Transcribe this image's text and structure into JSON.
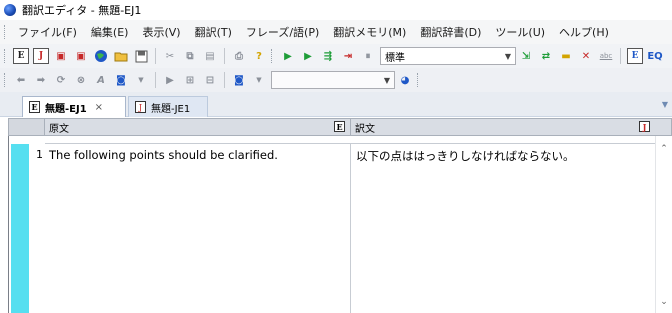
{
  "window": {
    "title": "翻訳エディタ - 無題-EJ1"
  },
  "menu": [
    {
      "label": "ファイル(F)",
      "name": "menu-file"
    },
    {
      "label": "編集(E)",
      "name": "menu-edit"
    },
    {
      "label": "表示(V)",
      "name": "menu-view"
    },
    {
      "label": "翻訳(T)",
      "name": "menu-translate"
    },
    {
      "label": "フレーズ/語(P)",
      "name": "menu-phrase"
    },
    {
      "label": "翻訳メモリ(M)",
      "name": "menu-translation-memory"
    },
    {
      "label": "翻訳辞書(D)",
      "name": "menu-dictionary"
    },
    {
      "label": "ツール(U)",
      "name": "menu-tools"
    },
    {
      "label": "ヘルプ(H)",
      "name": "menu-help"
    }
  ],
  "toolbar": {
    "style_combo_value": "標準",
    "main_combo_value": "",
    "abc_label": "abc"
  },
  "tabs": [
    {
      "label": "無題-EJ1",
      "icon_letter": "E",
      "close": "×",
      "active": true
    },
    {
      "label": "無題-JE1",
      "icon_letter": "J",
      "active": false
    }
  ],
  "grid": {
    "header_source": "原文",
    "header_target": "訳文",
    "source_icon_letter": "E",
    "target_icon_letter": "J",
    "rows": [
      {
        "number": "1",
        "source": "The following points should be clarified.",
        "target": "以下の点ははっきりしなければならない。"
      }
    ]
  },
  "colors": {
    "marker": "#56dff0",
    "menubar": "#f5f6f7",
    "toolbar": "#f1f3f6",
    "tabbar": "#e8ecf2",
    "header": "#d9dde4"
  }
}
